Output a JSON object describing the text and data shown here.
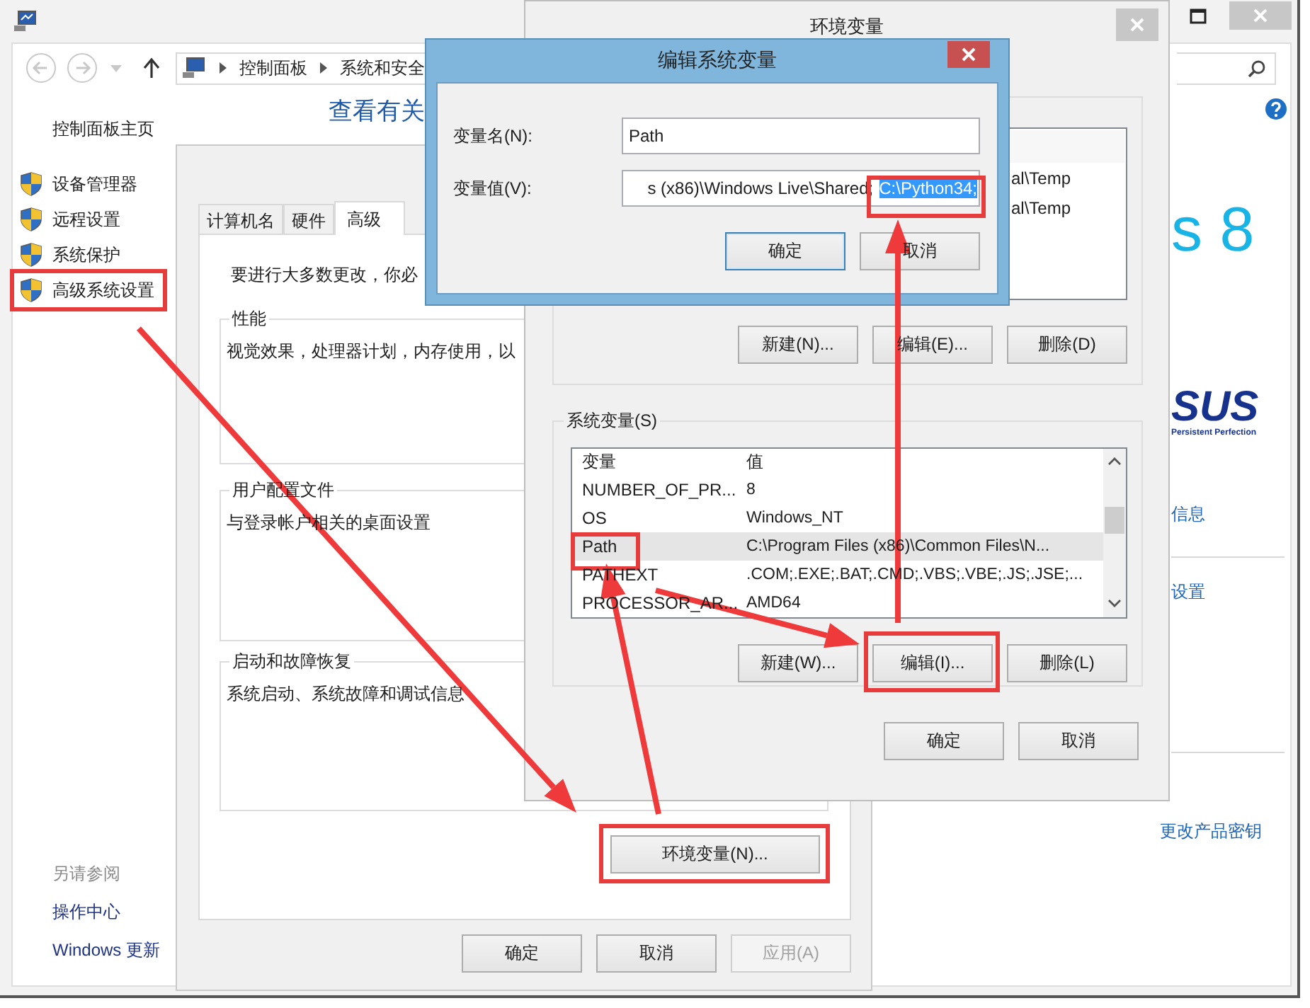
{
  "control_panel": {
    "address": [
      "控制面板",
      "系统和安全"
    ],
    "home_link": "控制面板主页",
    "sidebar_items": [
      "设备管理器",
      "远程设置",
      "系统保护",
      "高级系统设置"
    ],
    "see_also": {
      "heading": "另请参阅",
      "links": [
        "操作中心",
        "Windows 更新"
      ]
    },
    "heading": "查看有关",
    "windows_logo": "s 8",
    "oem_logo": {
      "brand": "SUS",
      "tagline": "Persistent Perfection"
    },
    "links": [
      "信息",
      "设置",
      "更改产品密钥"
    ]
  },
  "system_properties": {
    "tabs": [
      {
        "label": "计算机名",
        "selected": false
      },
      {
        "label": "硬件",
        "selected": false
      },
      {
        "label": "高级",
        "selected": true
      }
    ],
    "intro": "要进行大多数更改，你必",
    "groups": [
      {
        "title": "性能",
        "text": "视觉效果，处理器计划，内存使用，以"
      },
      {
        "title": "用户配置文件",
        "text": "与登录帐户相关的桌面设置"
      },
      {
        "title": "启动和故障恢复",
        "text": "系统启动、系统故障和调试信息"
      }
    ],
    "env_button": "环境变量(N)...",
    "buttons": [
      {
        "label": "确定",
        "disabled": false
      },
      {
        "label": "取消",
        "disabled": false
      },
      {
        "label": "应用(A)",
        "disabled": true
      }
    ]
  },
  "environment_variables": {
    "title": "环境变量",
    "user_variables": {
      "rows": [
        {
          "value": "al\\Temp"
        },
        {
          "value": "al\\Temp"
        }
      ],
      "buttons": [
        "新建(N)...",
        "编辑(E)...",
        "删除(D)"
      ]
    },
    "system_variables": {
      "title": "系统变量(S)",
      "columns": [
        "变量",
        "值"
      ],
      "rows": [
        {
          "name": "NUMBER_OF_PR...",
          "value": "8",
          "selected": false
        },
        {
          "name": "OS",
          "value": "Windows_NT",
          "selected": false
        },
        {
          "name": "Path",
          "value": "C:\\Program Files (x86)\\Common Files\\N...",
          "selected": true
        },
        {
          "name": "PATHEXT",
          "value": ".COM;.EXE;.BAT;.CMD;.VBS;.VBE;.JS;.JSE;...",
          "selected": false
        },
        {
          "name": "PROCESSOR_AR...",
          "value": "AMD64",
          "selected": false
        }
      ],
      "buttons": [
        "新建(W)...",
        "编辑(I)...",
        "删除(L)"
      ]
    },
    "buttons": [
      "确定",
      "取消"
    ]
  },
  "edit_dialog": {
    "title": "编辑系统变量",
    "fields": [
      {
        "label": "变量名(N):",
        "value": "Path"
      },
      {
        "label": "变量值(V):",
        "value": "s (x86)\\Windows Live\\Shared;",
        "selection": "C:\\Python34;"
      }
    ],
    "buttons": [
      {
        "label": "确定",
        "focused": true
      },
      {
        "label": "取消",
        "focused": false
      }
    ]
  }
}
